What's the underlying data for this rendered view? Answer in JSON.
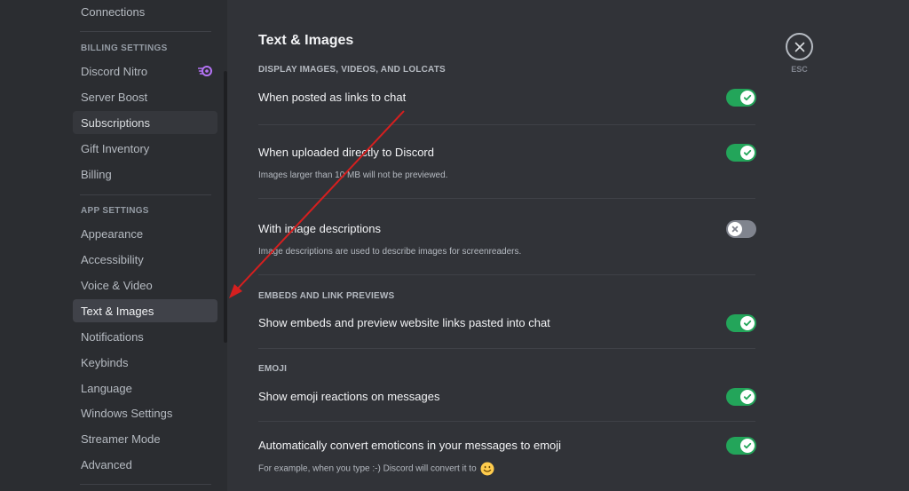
{
  "sidebar": {
    "top_item": "Connections",
    "billing_header": "BILLING SETTINGS",
    "billing_items": [
      "Discord Nitro",
      "Server Boost",
      "Subscriptions",
      "Gift Inventory",
      "Billing"
    ],
    "app_header": "APP SETTINGS",
    "app_items": [
      "Appearance",
      "Accessibility",
      "Voice & Video",
      "Text & Images",
      "Notifications",
      "Keybinds",
      "Language",
      "Windows Settings",
      "Streamer Mode",
      "Advanced"
    ],
    "active_item": "Text & Images",
    "hover_item": "Subscriptions",
    "nitro_icon": "nitro-icon"
  },
  "main": {
    "title": "Text & Images",
    "sections": [
      {
        "header": "DISPLAY IMAGES, VIDEOS, AND LOLCATS",
        "rows": [
          {
            "title": "When posted as links to chat",
            "desc": "",
            "enabled": true
          },
          {
            "title": "When uploaded directly to Discord",
            "desc": "Images larger than 10 MB will not be previewed.",
            "enabled": true
          },
          {
            "title": "With image descriptions",
            "desc": "Image descriptions are used to describe images for screenreaders.",
            "enabled": false
          }
        ]
      },
      {
        "header": "EMBEDS AND LINK PREVIEWS",
        "rows": [
          {
            "title": "Show embeds and preview website links pasted into chat",
            "desc": "",
            "enabled": true
          }
        ]
      },
      {
        "header": "EMOJI",
        "rows": [
          {
            "title": "Show emoji reactions on messages",
            "desc": "",
            "enabled": true
          },
          {
            "title": "Automatically convert emoticons in your messages to emoji",
            "desc": "For example, when you type :-) Discord will convert it to",
            "enabled": true
          }
        ]
      }
    ],
    "close_label": "ESC"
  },
  "colors": {
    "toggle_on": "#23a55a",
    "toggle_off": "#80848e",
    "annotation_arrow": "#d61f1f",
    "nitro": "#b473f5"
  }
}
